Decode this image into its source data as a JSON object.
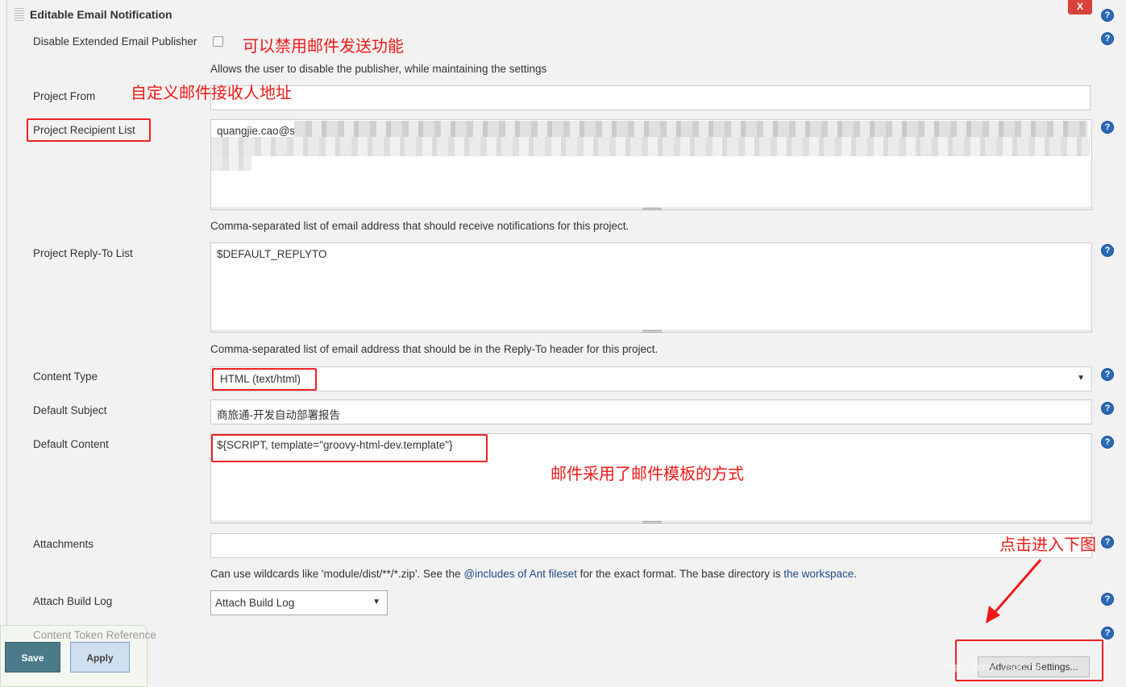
{
  "section": {
    "title": "Editable Email Notification",
    "close_label": "X"
  },
  "disable": {
    "label": "Disable Extended Email Publisher",
    "checked": false,
    "description": "Allows the user to disable the publisher, while maintaining the settings"
  },
  "project_from": {
    "label": "Project From",
    "value": ""
  },
  "recipient": {
    "label": "Project Recipient List",
    "value": "quangjie.cao@s",
    "description": "Comma-separated list of email address that should receive notifications for this project."
  },
  "reply_to": {
    "label": "Project Reply-To List",
    "value": "$DEFAULT_REPLYTO",
    "description": "Comma-separated list of email address that should be in the Reply-To header for this project."
  },
  "content_type": {
    "label": "Content Type",
    "value": "HTML (text/html)"
  },
  "subject": {
    "label": "Default Subject",
    "value": "商旅通-开发自动部署报告"
  },
  "content": {
    "label": "Default Content",
    "value": "${SCRIPT, template=\"groovy-html-dev.template\"}"
  },
  "attachments": {
    "label": "Attachments",
    "value": "",
    "desc_1": "Can use wildcards like 'module/dist/**/*.zip'. See the ",
    "link_1": "@includes of Ant fileset",
    "desc_2": " for the exact format. The base directory is ",
    "link_2": "the workspace",
    "desc_3": "."
  },
  "build_log": {
    "label": "Attach Build Log",
    "value": "Attach Build Log"
  },
  "token_ref": {
    "label": "Content Token Reference"
  },
  "buttons": {
    "save": "Save",
    "apply": "Apply",
    "advanced": "Advanced Settings..."
  },
  "help_label": "?",
  "annotations": {
    "disable": "可以禁用邮件发送功能",
    "recipient": "自定义邮件接收人地址",
    "template": "邮件采用了邮件模板的方式",
    "click": "点击进入下图"
  },
  "watermark": "https://jerry...csdn.net",
  "colors": {
    "annotation": "#f01818",
    "save": "#4b7a89",
    "apply": "#cfdff0"
  }
}
